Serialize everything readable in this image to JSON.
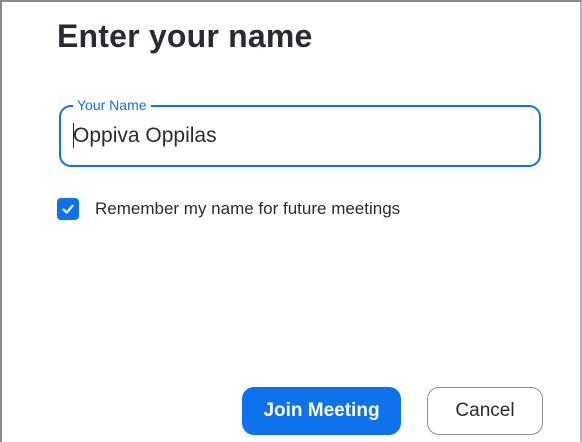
{
  "dialog": {
    "title": "Enter your name"
  },
  "name_field": {
    "label": "Your Name",
    "value": "Oppiva Oppilas"
  },
  "remember": {
    "checked": true,
    "label": "Remember my name for future meetings"
  },
  "buttons": {
    "join_label": "Join Meeting",
    "cancel_label": "Cancel"
  },
  "colors": {
    "accent": "#0e72ed",
    "text": "#2a2a33"
  },
  "icons": {
    "checkbox": "checkmark-icon"
  }
}
